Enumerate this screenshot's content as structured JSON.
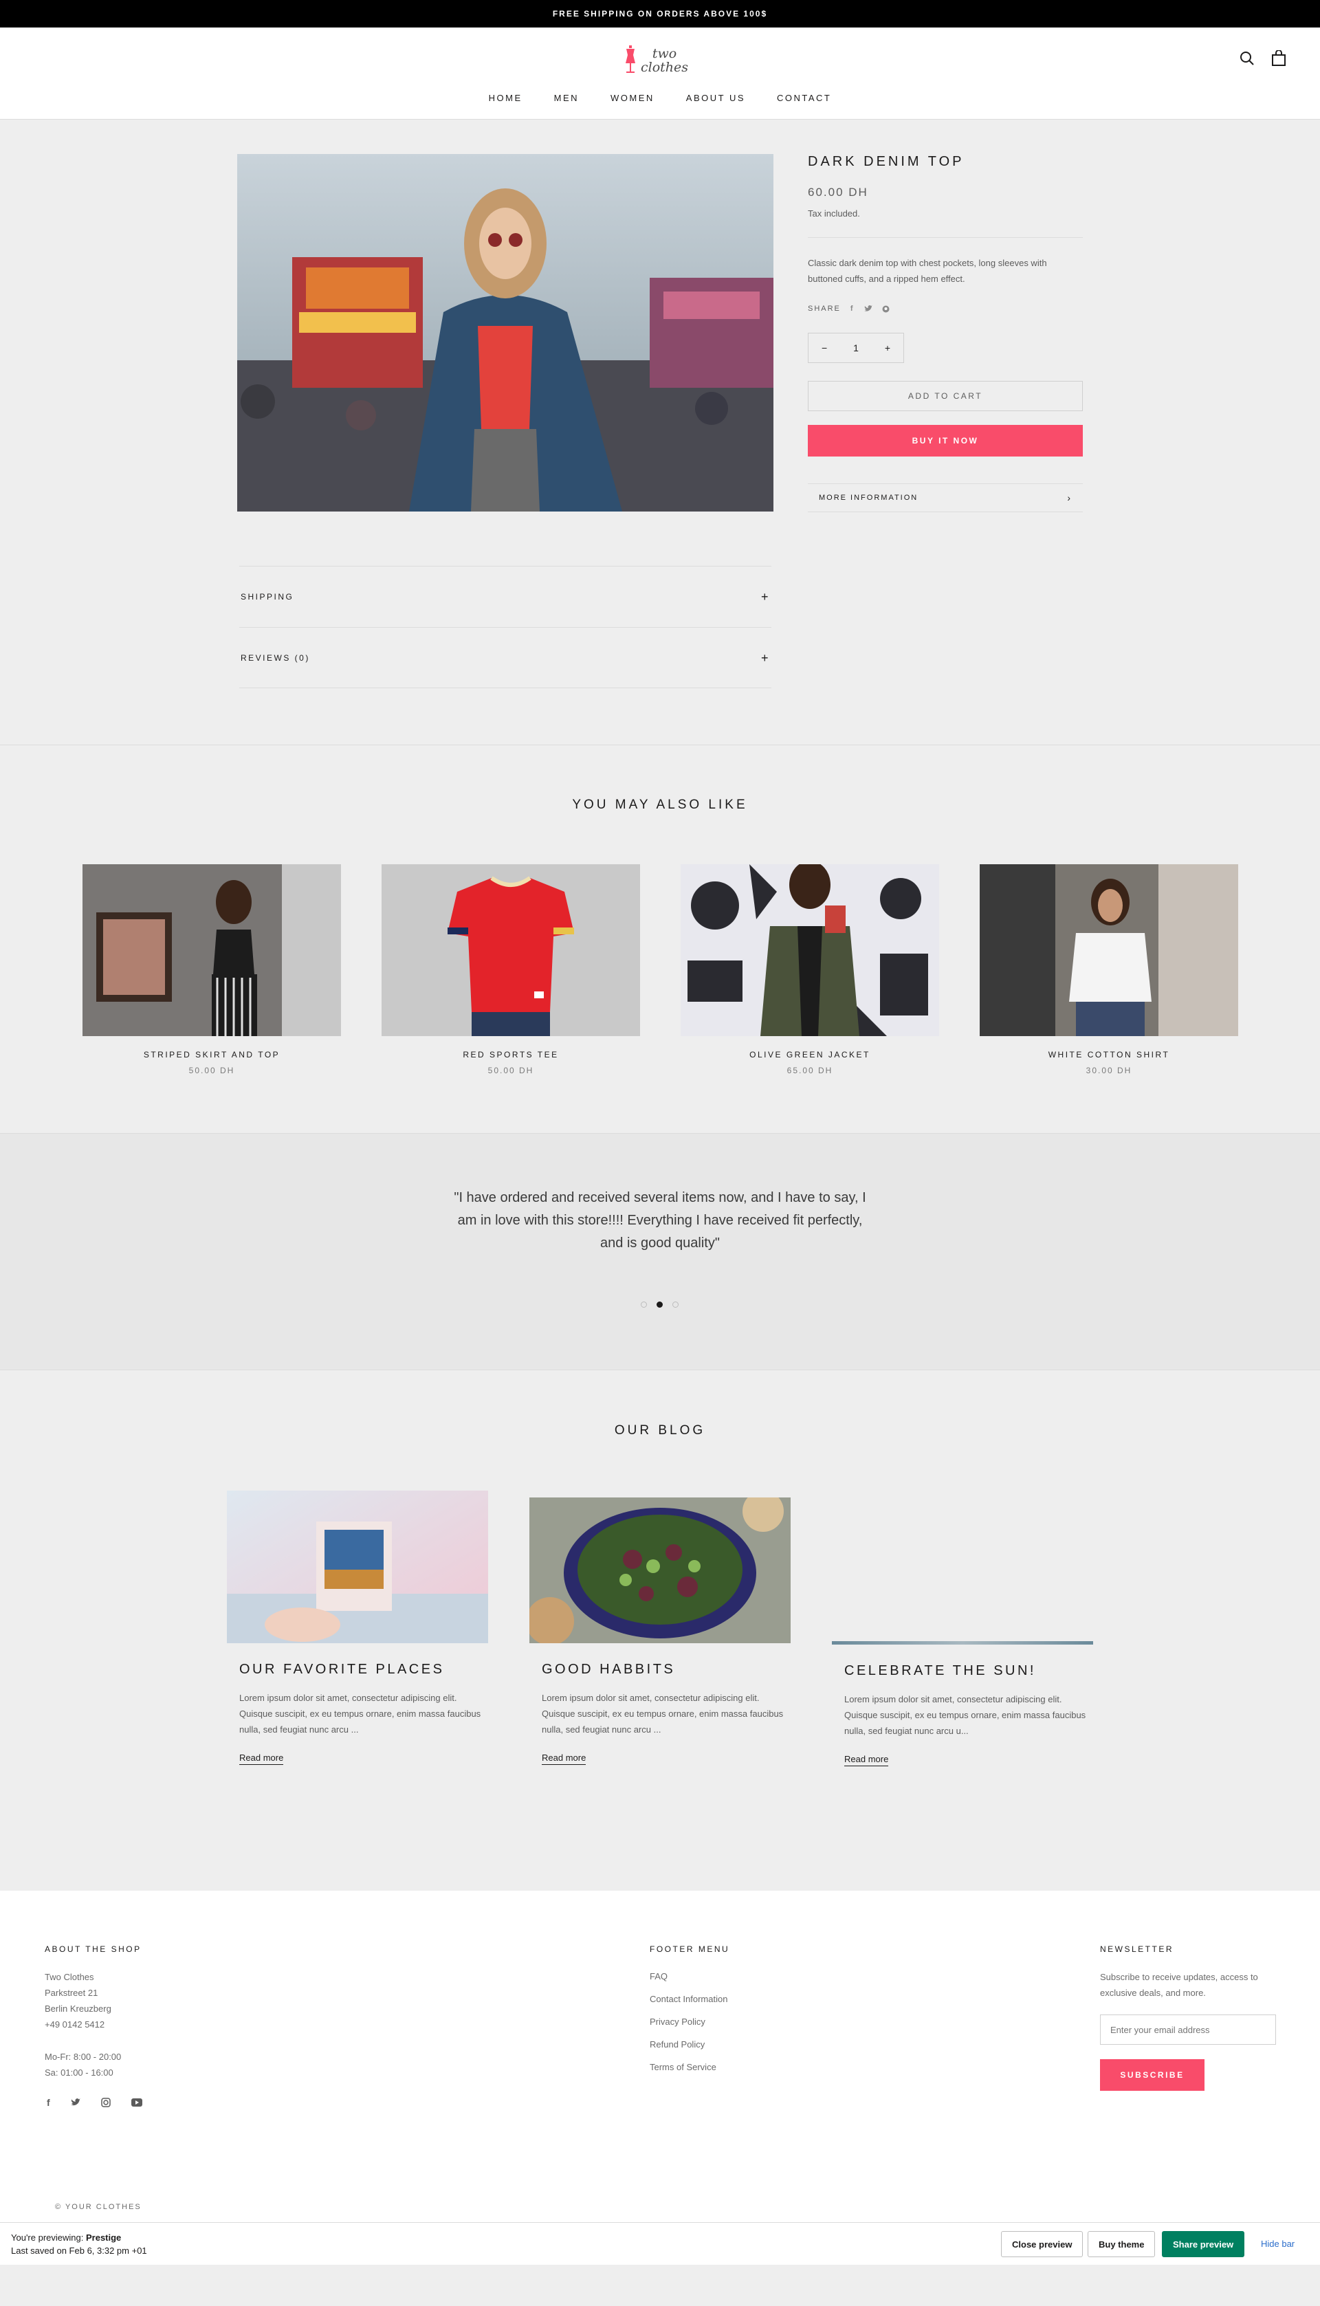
{
  "announcement": "FREE SHIPPING ON ORDERS ABOVE 100$",
  "header": {
    "logo_line1": "two",
    "logo_line2": "clothes",
    "nav": [
      "HOME",
      "MEN",
      "WOMEN",
      "ABOUT US",
      "CONTACT"
    ],
    "icons": [
      "search-icon",
      "cart-icon"
    ]
  },
  "product": {
    "title": "DARK DENIM TOP",
    "price": "60.00 DH",
    "tax_note": "Tax included.",
    "description": "Classic dark denim top with chest pockets, long sleeves with buttoned cuffs, and a ripped hem effect.",
    "share_label": "SHARE",
    "quantity": "1",
    "add_to_cart": "ADD TO CART",
    "buy_now": "BUY IT NOW",
    "more_info": "MORE INFORMATION",
    "accordions": [
      "SHIPPING",
      "REVIEWS (0)"
    ]
  },
  "related": {
    "title": "YOU MAY ALSO LIKE",
    "items": [
      {
        "name": "STRIPED SKIRT AND TOP",
        "price": "50.00 DH"
      },
      {
        "name": "RED SPORTS TEE",
        "price": "50.00 DH"
      },
      {
        "name": "OLIVE GREEN JACKET",
        "price": "65.00 DH"
      },
      {
        "name": "WHITE COTTON SHIRT",
        "price": "30.00 DH"
      }
    ]
  },
  "testimonial": {
    "text": "\"I have ordered and received several items now, and I have to say, I am in love with this store!!!! Everything I have received fit perfectly, and is good quality\"",
    "active_slide": 2,
    "slides": 3
  },
  "blog": {
    "title": "OUR BLOG",
    "posts": [
      {
        "title": "OUR FAVORITE PLACES",
        "excerpt": "Lorem ipsum dolor sit amet, consectetur adipiscing elit. Quisque suscipit, ex eu tempus ornare, enim massa faucibus nulla, sed feugiat nunc arcu ...",
        "link": "Read more"
      },
      {
        "title": "GOOD HABBITS",
        "excerpt": "Lorem ipsum dolor sit amet, consectetur adipiscing elit. Quisque suscipit, ex eu tempus ornare, enim massa faucibus nulla, sed feugiat nunc arcu ...",
        "link": "Read more"
      },
      {
        "title": "CELEBRATE THE SUN!",
        "excerpt": "Lorem ipsum dolor sit amet, consectetur adipiscing elit. Quisque suscipit, ex eu tempus ornare, enim massa faucibus nulla, sed feugiat nunc arcu u...",
        "link": "Read more"
      }
    ]
  },
  "footer": {
    "about_title": "ABOUT THE SHOP",
    "address": [
      "Two Clothes",
      "Parkstreet 21",
      "Berlin Kreuzberg",
      "+49 0142 5412"
    ],
    "hours": [
      "Mo-Fr: 8:00 - 20:00",
      "Sa: 01:00 - 16:00"
    ],
    "social_icons": [
      "facebook-icon",
      "twitter-icon",
      "instagram-icon",
      "youtube-icon"
    ],
    "menu_title": "FOOTER MENU",
    "menu": [
      "FAQ",
      "Contact Information",
      "Privacy Policy",
      "Refund Policy",
      "Terms of Service"
    ],
    "newsletter_title": "NEWSLETTER",
    "newsletter_text": "Subscribe to receive updates, access to exclusive deals, and more.",
    "email_placeholder": "Enter your email address",
    "subscribe": "SUBSCRIBE",
    "copyright": "© YOUR CLOTHES"
  },
  "preview_bar": {
    "previewing_label": "You're previewing:",
    "theme_name": "Prestige",
    "last_saved": "Last saved on Feb 6, 3:32 pm +01",
    "close_preview": "Close preview",
    "buy_theme": "Buy theme",
    "share_preview": "Share preview",
    "hide_bar": "Hide bar"
  },
  "colors": {
    "accent": "#f94c6a",
    "background": "#eeeeee",
    "text": "#1c1b1b",
    "shopify_green": "#008060"
  }
}
